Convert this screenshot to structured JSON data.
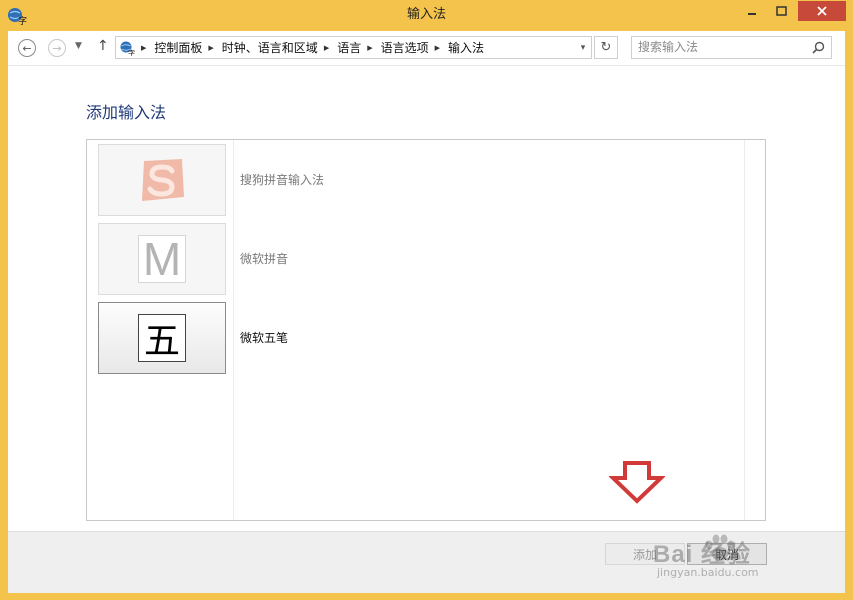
{
  "window": {
    "title": "输入法"
  },
  "navigation": {
    "breadcrumb": [
      "控制面板",
      "时钟、语言和区域",
      "语言",
      "语言选项",
      "输入法"
    ],
    "search_placeholder": "搜索输入法"
  },
  "page": {
    "heading": "添加输入法"
  },
  "ime_list": [
    {
      "label": "搜狗拼音输入法",
      "icon": "sogou-logo",
      "selected": false
    },
    {
      "label": "微软拼音",
      "icon": "letter-m",
      "icon_text": "M",
      "selected": false
    },
    {
      "label": "微软五笔",
      "icon": "wubi-character",
      "icon_text": "五",
      "selected": true
    }
  ],
  "buttons": {
    "add": "添加",
    "cancel": "取消"
  },
  "watermark": {
    "brand": "Bai 经验",
    "url": "jingyan.baidu.com"
  },
  "colors": {
    "title_bar": "#f3c34b",
    "heading": "#1e3a78",
    "arrow": "#d23a3a"
  }
}
